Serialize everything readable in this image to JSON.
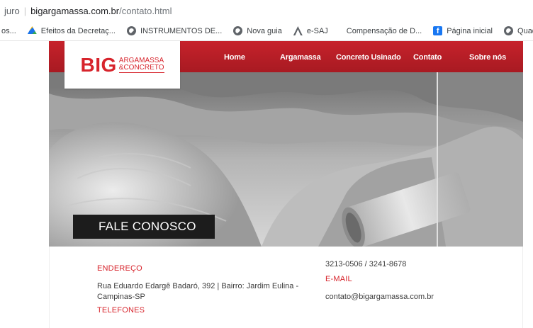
{
  "browser": {
    "secure_fragment": "juro",
    "domain": "bigargamassa.com.br",
    "path": "/contato.html"
  },
  "bookmarks": [
    {
      "icon": "truncated",
      "label": "os..."
    },
    {
      "icon": "google-drive-icon",
      "label": "Efeitos da Decretaç..."
    },
    {
      "icon": "globe-icon",
      "label": "INSTRUMENTOS DE..."
    },
    {
      "icon": "globe-icon",
      "label": "Nova guia"
    },
    {
      "icon": "esaj-icon",
      "label": "e-SAJ"
    },
    {
      "icon": "blank",
      "label": "Compensação de D..."
    },
    {
      "icon": "facebook-icon",
      "label": "Página inicial"
    },
    {
      "icon": "globe-icon",
      "label": "Quadro-comparativ..."
    }
  ],
  "site": {
    "logo": {
      "big": "BIG",
      "line1": "ARGAMASSA",
      "line2": "&CONCRETO"
    },
    "nav": [
      "Home",
      "Argamassa",
      "Concreto Usinado",
      "Contato",
      "Sobre nós"
    ],
    "hero_title": "FALE CONOSCO",
    "contact": {
      "endereco_label": "ENDEREÇO",
      "endereco_value": "Rua Eduardo Edargê Badaró, 392 | Bairro: Jardim Eulina - Campinas-SP",
      "telefones_label": "TELEFONES",
      "telefones_value": "3213-0506 / 3241-8678",
      "email_label": "E-MAIL",
      "email_value": "contato@bigargamassa.com.br"
    },
    "colors": {
      "brand_red": "#d7242c",
      "header_red": "#b81e27",
      "title_bg": "#1c1c1c"
    }
  }
}
